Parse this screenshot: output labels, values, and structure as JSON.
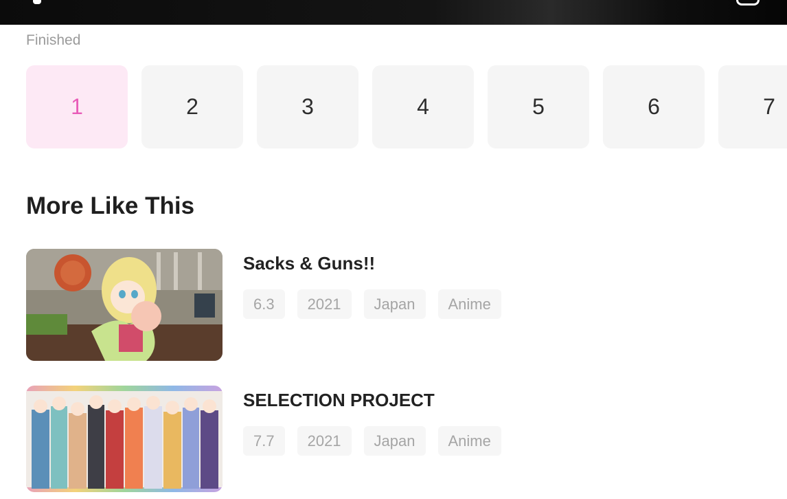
{
  "status": "Finished",
  "episodes": [
    "1",
    "2",
    "3",
    "4",
    "5",
    "6",
    "7"
  ],
  "selected_episode": "1",
  "section_title": "More Like This",
  "recommendations": [
    {
      "title": "Sacks & Guns!!",
      "rating": "6.3",
      "year": "2021",
      "region": "Japan",
      "genre": "Anime"
    },
    {
      "title": "SELECTION PROJECT",
      "rating": "7.7",
      "year": "2021",
      "region": "Japan",
      "genre": "Anime"
    }
  ],
  "colors": {
    "accent": "#e85cb8",
    "accent_bg": "#fde9f5",
    "tile_bg": "#f5f5f5",
    "tag_bg": "#f6f6f6",
    "tag_text": "#a5a5a5"
  }
}
